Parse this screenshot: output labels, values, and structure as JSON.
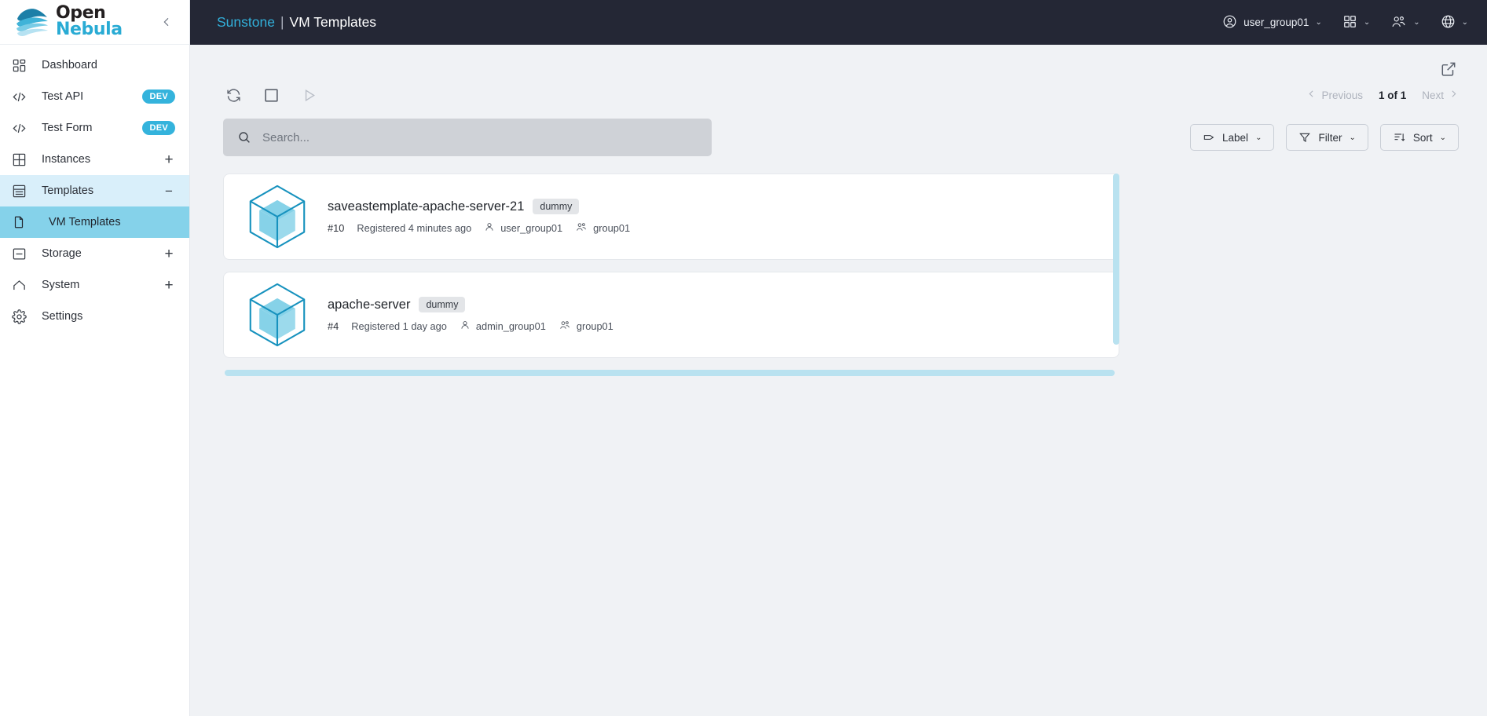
{
  "brand": {
    "logo_line1": "Open",
    "logo_line2": "Nebula",
    "collapse_icon": "chevron-left-icon",
    "accent_cyan": "#29abd4",
    "dark_navy": "#242735"
  },
  "sidebar": {
    "items": [
      {
        "label": "Dashboard",
        "icon": "dashboard-icon",
        "badge": null,
        "affordance": null,
        "state": "normal"
      },
      {
        "label": "Test API",
        "icon": "code-icon",
        "badge": "DEV",
        "affordance": null,
        "state": "normal"
      },
      {
        "label": "Test Form",
        "icon": "code-icon",
        "badge": "DEV",
        "affordance": null,
        "state": "normal"
      },
      {
        "label": "Instances",
        "icon": "grid-icon",
        "badge": null,
        "affordance": "+",
        "state": "normal"
      },
      {
        "label": "Templates",
        "icon": "templates-icon",
        "badge": null,
        "affordance": "−",
        "state": "expanded"
      },
      {
        "label": "VM Templates",
        "icon": "document-icon",
        "badge": null,
        "affordance": null,
        "state": "selected-sub"
      },
      {
        "label": "Storage",
        "icon": "storage-icon",
        "badge": null,
        "affordance": "+",
        "state": "normal"
      },
      {
        "label": "System",
        "icon": "home-icon",
        "badge": null,
        "affordance": "+",
        "state": "normal"
      },
      {
        "label": "Settings",
        "icon": "gear-icon",
        "badge": null,
        "affordance": null,
        "state": "normal"
      }
    ]
  },
  "header": {
    "app_name": "Sunstone",
    "separator": "|",
    "page_title": "VM Templates",
    "user": {
      "label": "user_group01",
      "icon": "user-circle-icon",
      "caret": "⌄"
    },
    "views_menu": {
      "icon": "grid-apps-icon",
      "caret": "⌄"
    },
    "group_menu": {
      "icon": "people-icon",
      "caret": "⌄"
    },
    "language_menu": {
      "icon": "globe-icon",
      "caret": "⌄"
    }
  },
  "toolbar": {
    "export_icon": "external-link-icon",
    "refresh_icon": "refresh-icon",
    "select_all_icon": "checkbox-empty-icon",
    "play_icon": "play-triangle-icon"
  },
  "pagination": {
    "previous_label": "Previous",
    "page_indicator": "1 of 1",
    "next_label": "Next",
    "prev_icon": "chevron-left-icon",
    "next_icon": "chevron-right-icon"
  },
  "search": {
    "value": "",
    "placeholder": "Search...",
    "icon": "search-icon"
  },
  "filters": [
    {
      "label": "Label",
      "icon": "tag-icon",
      "caret": "⌄"
    },
    {
      "label": "Filter",
      "icon": "funnel-icon",
      "caret": "⌄"
    },
    {
      "label": "Sort",
      "icon": "sort-icon",
      "caret": "⌄"
    }
  ],
  "templates": [
    {
      "name": "saveastemplate-apache-server-21",
      "tag": "dummy",
      "id": "#10",
      "registered": "Registered 4 minutes ago",
      "owner": "user_group01",
      "group": "group01",
      "icon": "cube-icon"
    },
    {
      "name": "apache-server",
      "tag": "dummy",
      "id": "#4",
      "registered": "Registered 1 day ago",
      "owner": "admin_group01",
      "group": "group01",
      "icon": "cube-icon"
    }
  ],
  "scrollbars": {
    "vertical": "vertical-scrollbar",
    "horizontal": "horizontal-scrollbar",
    "color": "#b9e2f0"
  }
}
